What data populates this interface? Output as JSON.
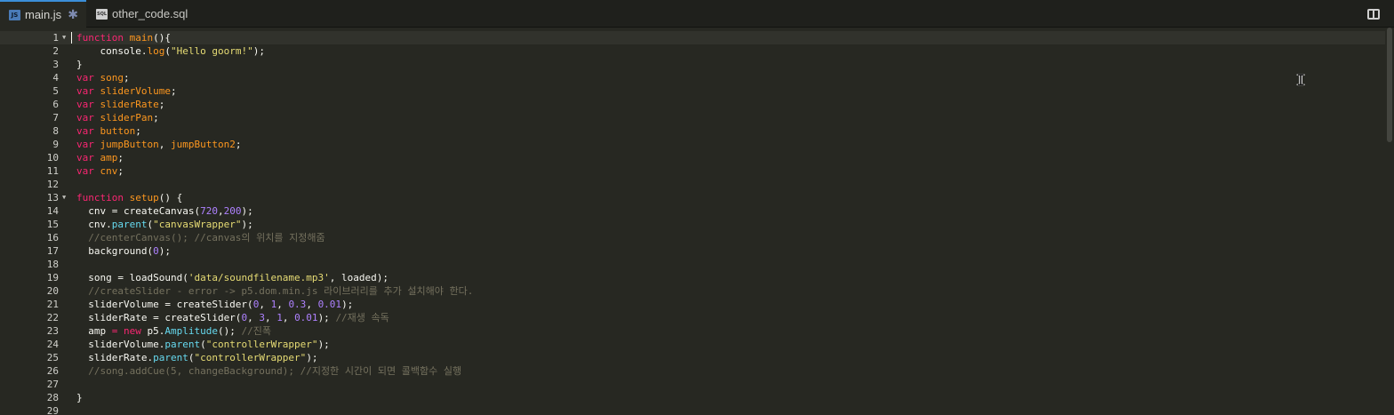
{
  "tabs": [
    {
      "name": "main.js",
      "icon": "js-file-icon",
      "icon_text": "JS",
      "active": true,
      "modified_marker": "✱"
    },
    {
      "name": "other_code.sql",
      "icon": "sql-file-icon",
      "icon_text": "SQL",
      "active": false
    }
  ],
  "toolbar": {
    "split_icon": "split-view-icon"
  },
  "editor": {
    "language": "javascript",
    "cursor_line": 1,
    "colors": {
      "background": "#272822",
      "keyword": "#f92672",
      "function": "#fd971f",
      "method": "#66d9ef",
      "string": "#e6db74",
      "number": "#ae81ff",
      "comment": "#75715e",
      "text": "#f8f8f2"
    },
    "lines": [
      {
        "n": "1",
        "fold": true,
        "tokens": [
          [
            "kw",
            "function"
          ],
          [
            "t",
            " "
          ],
          [
            "fn",
            "main"
          ],
          [
            "t",
            "(){"
          ]
        ]
      },
      {
        "n": "2",
        "tokens": [
          [
            "t",
            "    console."
          ],
          [
            "fn",
            "log"
          ],
          [
            "t",
            "("
          ],
          [
            "str",
            "\"Hello goorm!\""
          ],
          [
            "t",
            ");"
          ]
        ]
      },
      {
        "n": "3",
        "tokens": [
          [
            "t",
            "}"
          ]
        ]
      },
      {
        "n": "4",
        "tokens": [
          [
            "kw",
            "var"
          ],
          [
            "t",
            " "
          ],
          [
            "fn",
            "song"
          ],
          [
            "t",
            ";"
          ]
        ]
      },
      {
        "n": "5",
        "tokens": [
          [
            "kw",
            "var"
          ],
          [
            "t",
            " "
          ],
          [
            "fn",
            "sliderVolume"
          ],
          [
            "t",
            ";"
          ]
        ]
      },
      {
        "n": "6",
        "tokens": [
          [
            "kw",
            "var"
          ],
          [
            "t",
            " "
          ],
          [
            "fn",
            "sliderRate"
          ],
          [
            "t",
            ";"
          ]
        ]
      },
      {
        "n": "7",
        "tokens": [
          [
            "kw",
            "var"
          ],
          [
            "t",
            " "
          ],
          [
            "fn",
            "sliderPan"
          ],
          [
            "t",
            ";"
          ]
        ]
      },
      {
        "n": "8",
        "tokens": [
          [
            "kw",
            "var"
          ],
          [
            "t",
            " "
          ],
          [
            "fn",
            "button"
          ],
          [
            "t",
            ";"
          ]
        ]
      },
      {
        "n": "9",
        "tokens": [
          [
            "kw",
            "var"
          ],
          [
            "t",
            " "
          ],
          [
            "fn",
            "jumpButton"
          ],
          [
            "t",
            ", "
          ],
          [
            "fn",
            "jumpButton2"
          ],
          [
            "t",
            ";"
          ]
        ]
      },
      {
        "n": "10",
        "tokens": [
          [
            "kw",
            "var"
          ],
          [
            "t",
            " "
          ],
          [
            "fn",
            "amp"
          ],
          [
            "t",
            ";"
          ]
        ]
      },
      {
        "n": "11",
        "tokens": [
          [
            "kw",
            "var"
          ],
          [
            "t",
            " "
          ],
          [
            "fn",
            "cnv"
          ],
          [
            "t",
            ";"
          ]
        ]
      },
      {
        "n": "12",
        "tokens": []
      },
      {
        "n": "13",
        "fold": true,
        "tokens": [
          [
            "kw",
            "function"
          ],
          [
            "t",
            " "
          ],
          [
            "fn",
            "setup"
          ],
          [
            "t",
            "() {"
          ]
        ]
      },
      {
        "n": "14",
        "tokens": [
          [
            "t",
            "  cnv = createCanvas("
          ],
          [
            "num",
            "720"
          ],
          [
            "t",
            ","
          ],
          [
            "num",
            "200"
          ],
          [
            "t",
            ");"
          ]
        ]
      },
      {
        "n": "15",
        "tokens": [
          [
            "t",
            "  cnv."
          ],
          [
            "mth",
            "parent"
          ],
          [
            "t",
            "("
          ],
          [
            "str",
            "\"canvasWrapper\""
          ],
          [
            "t",
            ");"
          ]
        ]
      },
      {
        "n": "16",
        "tokens": [
          [
            "cm",
            "  //centerCanvas(); //canvas의 위치를 지정해줌"
          ]
        ]
      },
      {
        "n": "17",
        "tokens": [
          [
            "t",
            "  background("
          ],
          [
            "num",
            "0"
          ],
          [
            "t",
            ");"
          ]
        ]
      },
      {
        "n": "18",
        "tokens": []
      },
      {
        "n": "19",
        "tokens": [
          [
            "t",
            "  song = loadSound("
          ],
          [
            "str",
            "'data/soundfilename.mp3'"
          ],
          [
            "t",
            ", loaded);"
          ]
        ]
      },
      {
        "n": "20",
        "tokens": [
          [
            "cm",
            "  //createSlider - error -> p5.dom.min.js 라이브러리를 추가 설치해야 한다."
          ]
        ]
      },
      {
        "n": "21",
        "tokens": [
          [
            "t",
            "  sliderVolume = createSlider("
          ],
          [
            "num",
            "0"
          ],
          [
            "t",
            ", "
          ],
          [
            "num",
            "1"
          ],
          [
            "t",
            ", "
          ],
          [
            "num",
            "0.3"
          ],
          [
            "t",
            ", "
          ],
          [
            "num",
            "0.01"
          ],
          [
            "t",
            ");"
          ]
        ]
      },
      {
        "n": "22",
        "tokens": [
          [
            "t",
            "  sliderRate = createSlider("
          ],
          [
            "num",
            "0"
          ],
          [
            "t",
            ", "
          ],
          [
            "num",
            "3"
          ],
          [
            "t",
            ", "
          ],
          [
            "num",
            "1"
          ],
          [
            "t",
            ", "
          ],
          [
            "num",
            "0.01"
          ],
          [
            "t",
            "); "
          ],
          [
            "cm",
            "//재생 속독"
          ]
        ]
      },
      {
        "n": "23",
        "tokens": [
          [
            "t",
            "  amp "
          ],
          [
            "kw",
            "="
          ],
          [
            "t",
            " "
          ],
          [
            "kw",
            "new"
          ],
          [
            "t",
            " p5."
          ],
          [
            "mth",
            "Amplitude"
          ],
          [
            "t",
            "(); "
          ],
          [
            "cm",
            "//진폭"
          ]
        ]
      },
      {
        "n": "24",
        "tokens": [
          [
            "t",
            "  sliderVolume."
          ],
          [
            "mth",
            "parent"
          ],
          [
            "t",
            "("
          ],
          [
            "str",
            "\"controllerWrapper\""
          ],
          [
            "t",
            ");"
          ]
        ]
      },
      {
        "n": "25",
        "tokens": [
          [
            "t",
            "  sliderRate."
          ],
          [
            "mth",
            "parent"
          ],
          [
            "t",
            "("
          ],
          [
            "str",
            "\"controllerWrapper\""
          ],
          [
            "t",
            ");"
          ]
        ]
      },
      {
        "n": "26",
        "tokens": [
          [
            "cm",
            "  //song.addCue(5, changeBackground); //지정한 시간이 되면 콜백함수 실행"
          ]
        ]
      },
      {
        "n": "27",
        "tokens": []
      },
      {
        "n": "28",
        "tokens": [
          [
            "t",
            "}"
          ]
        ]
      },
      {
        "n": "29",
        "tokens": []
      }
    ]
  }
}
